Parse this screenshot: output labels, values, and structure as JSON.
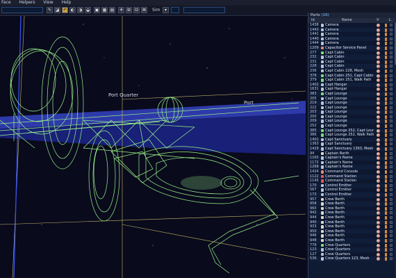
{
  "menu": [
    "Face",
    "Helpers",
    "View",
    "Help"
  ],
  "toolbar": {
    "zoom_label": "Sim",
    "buttons": [
      "✎",
      "◪",
      "↶",
      "◐",
      "◑",
      "◒",
      "▣",
      "▦",
      "▤",
      "✣",
      "⊞",
      "⊟",
      "⊠",
      "▾"
    ]
  },
  "viewport": {
    "label_port_quarter": "Port Quarter",
    "label_port": "Port",
    "wire_color": "#9cf58a",
    "plane_color": "#3c4ad6"
  },
  "panel": {
    "title": "Parts",
    "count": "(16)",
    "headers": {
      "id": "Id",
      "name": "Name",
      "v": "V",
      "l": "L"
    },
    "rows": [
      {
        "id": "1438",
        "name": "Camera",
        "icon": "#b9c6da"
      },
      {
        "id": "1443",
        "name": "Camera",
        "icon": "#b9c6da"
      },
      {
        "id": "1441",
        "name": "Camera",
        "icon": "#b9c6da"
      },
      {
        "id": "1440",
        "name": "Camera",
        "icon": "#b9c6da"
      },
      {
        "id": "1444",
        "name": "Camera",
        "icon": "#b9c6da"
      },
      {
        "id": "1209",
        "name": "Capacitor Service Panel",
        "icon": "#e08a6a"
      },
      {
        "id": "277",
        "name": "Capt Cabin",
        "icon": "#7fdc7a"
      },
      {
        "id": "232",
        "name": "Capt Cabin",
        "icon": "#b9c6da"
      },
      {
        "id": "231",
        "name": "Capt Cabin",
        "icon": "#b9c6da"
      },
      {
        "id": "228",
        "name": "Capt Cabin",
        "icon": "#b9c6da"
      },
      {
        "id": "236",
        "name": "Capt Cabin 228, Mesh",
        "icon": "#b9c6da"
      },
      {
        "id": "378",
        "name": "Capt Cabin 251, Capt Cabin",
        "icon": "#7fdc7a"
      },
      {
        "id": "379",
        "name": "Capt Cabin 251, Walk Path",
        "icon": "#7fdc7a"
      },
      {
        "id": "1402",
        "name": "Capt Hangar",
        "icon": "#b9c6da"
      },
      {
        "id": "1631",
        "name": "Capt Hangar",
        "icon": "#b9c6da"
      },
      {
        "id": "383",
        "name": "Capt Lounge",
        "icon": "#7fdc7a"
      },
      {
        "id": "205",
        "name": "Capt Lounge",
        "icon": "#b9c6da"
      },
      {
        "id": "219",
        "name": "Capt Lounge",
        "icon": "#b9c6da"
      },
      {
        "id": "222",
        "name": "Capt Lounge",
        "icon": "#b9c6da"
      },
      {
        "id": "203",
        "name": "Capt Lounge",
        "icon": "#b9c6da"
      },
      {
        "id": "200",
        "name": "Capt Lounge",
        "icon": "#b9c6da"
      },
      {
        "id": "209",
        "name": "Capt Lounge",
        "icon": "#b9c6da"
      },
      {
        "id": "252",
        "name": "Capt Lounge",
        "icon": "#b9c6da"
      },
      {
        "id": "385",
        "name": "Capt Lounge 252, Capt Lounge",
        "icon": "#7fdc7a"
      },
      {
        "id": "386",
        "name": "Capt Lounge 252, Walk Path",
        "icon": "#7fdc7a"
      },
      {
        "id": "1401",
        "name": "Capt Sanctuary",
        "icon": "#b9c6da"
      },
      {
        "id": "1363",
        "name": "Capt Sanctuary",
        "icon": "#b9c6da"
      },
      {
        "id": "1429",
        "name": "Capt Sanctuary 1363, Mesh",
        "icon": "#b9c6da"
      },
      {
        "id": "94",
        "name": "Captain Berth",
        "icon": "#e0d9c8"
      },
      {
        "id": "1165",
        "name": "Captain's Name",
        "icon": "#b9c6da"
      },
      {
        "id": "1172",
        "name": "Captain's Name",
        "icon": "#b9c6da"
      },
      {
        "id": "1268",
        "name": "Captain's Name",
        "icon": "#b9c6da"
      },
      {
        "id": "1424",
        "name": "Command Console",
        "icon": "#e08a6a"
      },
      {
        "id": "1122",
        "name": "Command Station",
        "icon": "#e05a5a"
      },
      {
        "id": "1145",
        "name": "Command Station",
        "icon": "#e05a5a"
      },
      {
        "id": "170",
        "name": "Control Emitter",
        "icon": "#b9c6da"
      },
      {
        "id": "567",
        "name": "Control Emitter",
        "icon": "#b9c6da"
      },
      {
        "id": "173",
        "name": "Control Emitter",
        "icon": "#b9c6da"
      },
      {
        "id": "957",
        "name": "Crew Berth",
        "icon": "#e0d9c8"
      },
      {
        "id": "958",
        "name": "Crew Berth",
        "icon": "#e0d9c8"
      },
      {
        "id": "960",
        "name": "Crew Berth",
        "icon": "#e0d9c8"
      },
      {
        "id": "942",
        "name": "Crew Berth",
        "icon": "#e0d9c8"
      },
      {
        "id": "944",
        "name": "Crew Berth",
        "icon": "#e0d9c8"
      },
      {
        "id": "940",
        "name": "Crew Berth",
        "icon": "#e0d9c8"
      },
      {
        "id": "933",
        "name": "Crew Berth",
        "icon": "#e0d9c8"
      },
      {
        "id": "950",
        "name": "Crew Berth",
        "icon": "#e0d9c8"
      },
      {
        "id": "946",
        "name": "Crew Berth",
        "icon": "#e0d9c8"
      },
      {
        "id": "948",
        "name": "Crew Berth",
        "icon": "#e0d9c8"
      },
      {
        "id": "778",
        "name": "Crew Quarters",
        "icon": "#7fdc7a"
      },
      {
        "id": "123",
        "name": "Crew Quarters",
        "icon": "#b9c6da"
      },
      {
        "id": "127",
        "name": "Crew Quarters",
        "icon": "#b9c6da"
      },
      {
        "id": "536",
        "name": "Crew Quarters 123, Mesh",
        "icon": "#b9c6da"
      }
    ]
  }
}
